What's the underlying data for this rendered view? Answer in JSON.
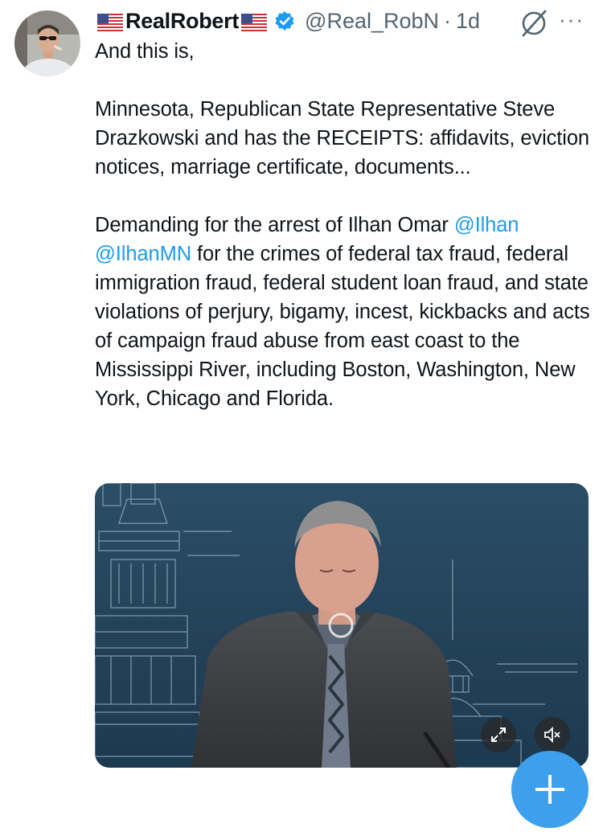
{
  "tweet": {
    "display_name": "RealRobert",
    "handle": "@Real_RobN",
    "separator": "·",
    "time": "1d",
    "more_label": "···",
    "paragraph1": "And this is,",
    "paragraph2": "Minnesota, Republican State Representative Steve Drazkowski and has the RECEIPTS: affidavits, eviction notices, marriage certificate, documents...",
    "paragraph3_start": "Demanding for the arrest of Ilhan Omar ",
    "mention1": "@Ilhan",
    "mention2": "@IlhanMN",
    "paragraph3_end": " for the crimes of federal tax fraud, federal immigration fraud, federal student loan fraud, and state violations of perjury, bigamy, incest, kickbacks and acts of campaign fraud abuse from east coast to the Mississippi River, including Boston, Washington, New York, Chicago and Florida."
  },
  "icons": {
    "flag": "us-flag-icon",
    "verified": "verified-badge-icon",
    "grok": "grok-icon",
    "expand": "expand-icon",
    "mute": "muted-speaker-icon"
  },
  "colors": {
    "link": "#1d9bf0",
    "verified": "#1d9bf0",
    "secondary_text": "#536471",
    "fab": "#3ea0ec"
  }
}
